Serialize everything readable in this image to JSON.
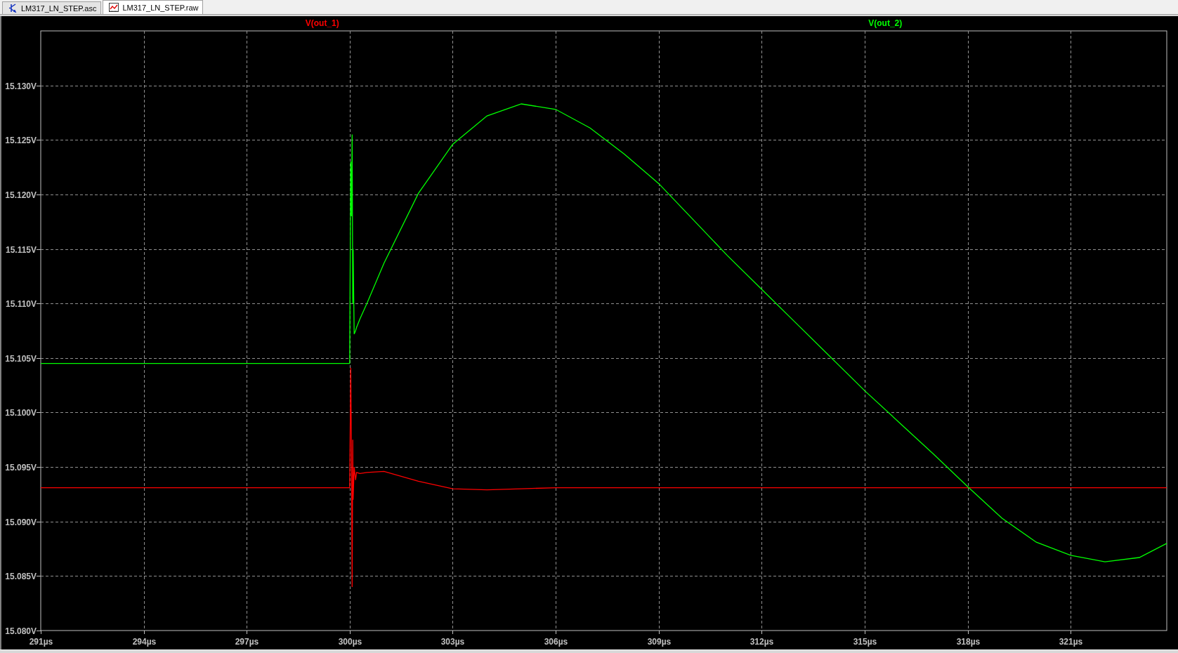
{
  "tabs": [
    {
      "label": "LM317_LN_STEP.asc",
      "kind": "schematic",
      "selected": false
    },
    {
      "label": "LM317_LN_STEP.raw",
      "kind": "waveform",
      "selected": true
    }
  ],
  "plot": {
    "chart_data": {
      "type": "line",
      "x": [
        291,
        300,
        300.03,
        300.05,
        300.07,
        300.09,
        300.1,
        300.13,
        300.17,
        300.2,
        300.3,
        300.5,
        301,
        302,
        303,
        304,
        305,
        306,
        307,
        308,
        309,
        310,
        311,
        312,
        313,
        314,
        315,
        316,
        317,
        318,
        319,
        320,
        321,
        322,
        323,
        323.8
      ],
      "series": [
        {
          "name": "V(out_1)",
          "color": "#ff0000",
          "values": [
            15.0931,
            15.0931,
            15.1041,
            15.0965,
            15.084,
            15.0975,
            15.092,
            15.095,
            15.0938,
            15.0945,
            15.0944,
            15.0945,
            15.0946,
            15.0937,
            15.093,
            15.0929,
            15.093,
            15.0931,
            15.0931,
            15.0931,
            15.0931,
            15.0931,
            15.0931,
            15.0931,
            15.0931,
            15.0931,
            15.0931,
            15.0931,
            15.0931,
            15.0931,
            15.0931,
            15.0931,
            15.0931,
            15.0931,
            15.0931,
            15.0931
          ]
        },
        {
          "name": "V(out_2)",
          "color": "#00ff00",
          "values": [
            15.1045,
            15.1045,
            15.123,
            15.118,
            15.1255,
            15.11,
            15.115,
            15.1072,
            15.1075,
            15.1078,
            15.1086,
            15.11,
            15.1137,
            15.1201,
            15.1246,
            15.1272,
            15.1283,
            15.1278,
            15.1261,
            15.1237,
            15.121,
            15.1177,
            15.1144,
            15.1113,
            15.1082,
            15.1051,
            15.102,
            15.0991,
            15.0962,
            15.0932,
            15.0903,
            15.0881,
            15.0869,
            15.0863,
            15.0867,
            15.088
          ]
        }
      ],
      "grid": true,
      "xlim": [
        291,
        323.8
      ],
      "ylim": [
        15.08,
        15.135
      ],
      "xticks": [
        {
          "value": 291,
          "label": "291µs"
        },
        {
          "value": 294,
          "label": "294µs"
        },
        {
          "value": 297,
          "label": "297µs"
        },
        {
          "value": 300,
          "label": "300µs"
        },
        {
          "value": 303,
          "label": "303µs"
        },
        {
          "value": 306,
          "label": "306µs"
        },
        {
          "value": 309,
          "label": "309µs"
        },
        {
          "value": 312,
          "label": "312µs"
        },
        {
          "value": 315,
          "label": "315µs"
        },
        {
          "value": 318,
          "label": "318µs"
        },
        {
          "value": 321,
          "label": "321µs"
        }
      ],
      "yticks": [
        {
          "value": 15.08,
          "label": "15.080V"
        },
        {
          "value": 15.085,
          "label": "15.085V"
        },
        {
          "value": 15.09,
          "label": "15.090V"
        },
        {
          "value": 15.095,
          "label": "15.095V"
        },
        {
          "value": 15.1,
          "label": "15.100V"
        },
        {
          "value": 15.105,
          "label": "15.105V"
        },
        {
          "value": 15.11,
          "label": "15.110V"
        },
        {
          "value": 15.115,
          "label": "15.115V"
        },
        {
          "value": 15.12,
          "label": "15.120V"
        },
        {
          "value": 15.125,
          "label": "15.125V"
        },
        {
          "value": 15.13,
          "label": "15.130V"
        }
      ]
    }
  }
}
